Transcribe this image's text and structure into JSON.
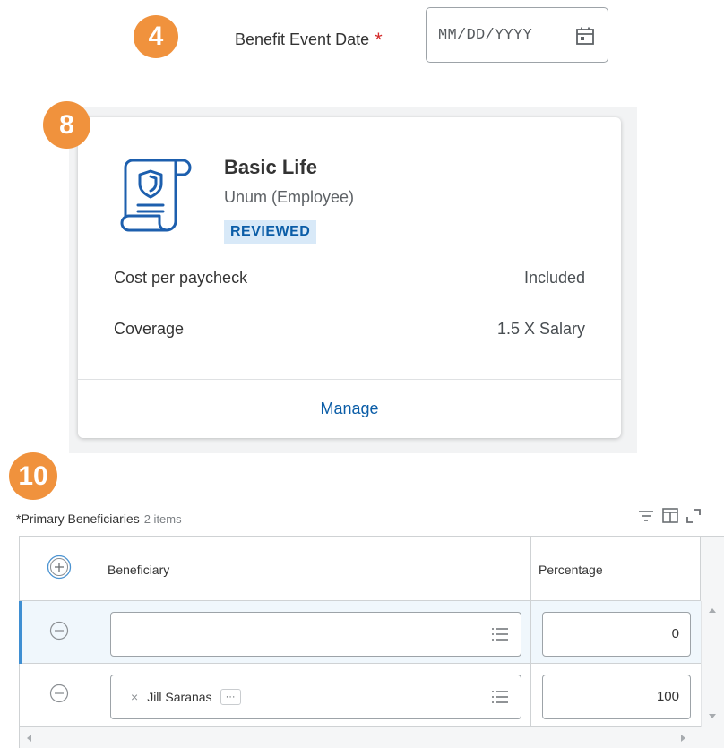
{
  "steps": {
    "date_step": "4",
    "plan_step": "8",
    "beneficiary_step": "10"
  },
  "event_date": {
    "label": "Benefit Event Date",
    "required_marker": "*",
    "placeholder": "MM/DD/YYYY",
    "icon": "calendar-icon"
  },
  "plan_card": {
    "icon": "policy-scroll-shield-icon",
    "name": "Basic Life",
    "carrier": "Unum (Employee)",
    "status": "REVIEWED",
    "rows": [
      {
        "label": "Cost per paycheck",
        "value": "Included"
      },
      {
        "label": "Coverage",
        "value": "1.5 X Salary"
      }
    ],
    "action": "Manage"
  },
  "beneficiaries": {
    "title": "*Primary Beneficiaries",
    "count": "2 items",
    "toolbar_icons": [
      "filter-icon",
      "columns-icon",
      "fullscreen-icon"
    ],
    "columns": {
      "beneficiary": "Beneficiary",
      "percentage": "Percentage"
    },
    "rows": [
      {
        "beneficiary": "",
        "percentage": "0"
      },
      {
        "beneficiary": "Jill Saranas",
        "percentage": "100"
      }
    ],
    "pill_more": "···",
    "pill_remove": "×"
  },
  "colors": {
    "badge": "#f0923d",
    "link": "#0b5da7",
    "status_bg": "#d8e9f8",
    "required": "#d42a2a",
    "row_selected": "#f0f7fc",
    "row_accent": "#3f8fd2"
  }
}
